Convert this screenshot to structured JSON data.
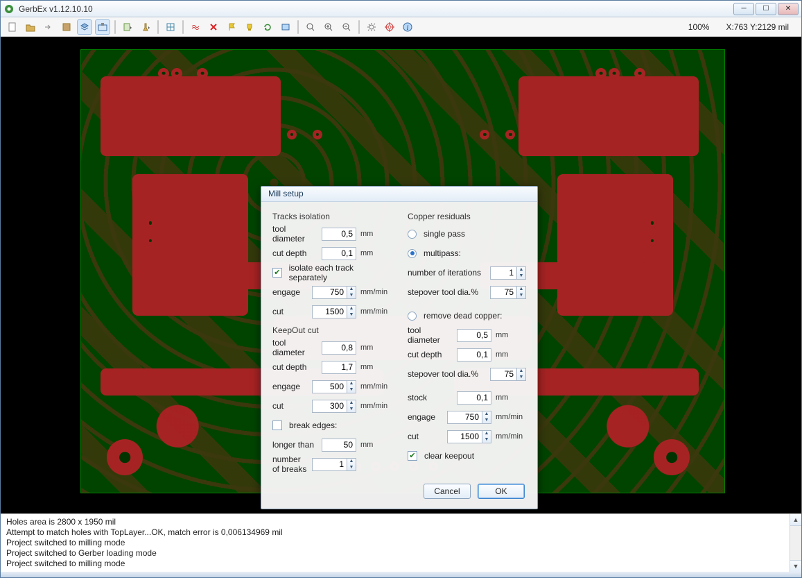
{
  "window": {
    "title": "GerbEx v1.12.10.10"
  },
  "toolbar": {
    "zoom": "100%",
    "coords": "X:763  Y:2129 mil",
    "icons": [
      "file-new-icon",
      "file-open-icon",
      "arrow-right-icon",
      "thumb-icon",
      "layers-icon",
      "cnc-icon",
      "sep",
      "gerber-dropdown-icon",
      "drill-dropdown-icon",
      "sep",
      "grid-icon",
      "sep",
      "approx-icon",
      "delete-x-icon",
      "flag-icon",
      "trophy-icon",
      "refresh-icon",
      "board-icon",
      "sep",
      "zoom-icon",
      "zoom-in-icon",
      "zoom-out-icon",
      "sep",
      "settings-gear-icon",
      "target-icon",
      "info-icon"
    ]
  },
  "dialog": {
    "title": "Mill setup",
    "tracks_isolation": {
      "heading": "Tracks isolation",
      "tool_diameter": {
        "label": "tool diameter",
        "value": "0,5",
        "unit": "mm"
      },
      "cut_depth": {
        "label": "cut depth",
        "value": "0,1",
        "unit": "mm"
      },
      "isolate_each": {
        "label": "isolate each track separately",
        "checked": true
      },
      "engage": {
        "label": "engage",
        "value": "750",
        "unit": "mm/min"
      },
      "cut": {
        "label": "cut",
        "value": "1500",
        "unit": "mm/min"
      }
    },
    "keepout_cut": {
      "heading": "KeepOut cut",
      "tool_diameter": {
        "label": "tool diameter",
        "value": "0,8",
        "unit": "mm"
      },
      "cut_depth": {
        "label": "cut depth",
        "value": "1,7",
        "unit": "mm"
      },
      "engage": {
        "label": "engage",
        "value": "500",
        "unit": "mm/min"
      },
      "cut": {
        "label": "cut",
        "value": "300",
        "unit": "mm/min"
      },
      "break_edges": {
        "label": "break edges:",
        "checked": false
      },
      "longer_than": {
        "label": "longer than",
        "value": "50",
        "unit": "mm"
      },
      "number_of_breaks": {
        "label": "number of breaks",
        "value": "1"
      }
    },
    "copper_residuals": {
      "heading": "Copper residuals",
      "single_pass": {
        "label": "single pass",
        "selected": false
      },
      "multipass": {
        "label": "multipass:",
        "selected": true
      },
      "number_of_iterations": {
        "label": "number of iterations",
        "value": "1"
      },
      "stepover_tool_dia": {
        "label": "stepover tool dia.%",
        "value": "75"
      },
      "remove_dead_copper": {
        "label": "remove dead copper:",
        "selected": false
      },
      "rdc_tool_diameter": {
        "label": "tool diameter",
        "value": "0,5",
        "unit": "mm"
      },
      "rdc_cut_depth": {
        "label": "cut depth",
        "value": "0,1",
        "unit": "mm"
      },
      "rdc_stepover": {
        "label": "stepover tool dia.%",
        "value": "75"
      },
      "stock": {
        "label": "stock",
        "value": "0,1",
        "unit": "mm"
      },
      "engage": {
        "label": "engage",
        "value": "750",
        "unit": "mm/min"
      },
      "cut": {
        "label": "cut",
        "value": "1500",
        "unit": "mm/min"
      },
      "clear_keepout": {
        "label": "clear keepout",
        "checked": true
      }
    },
    "buttons": {
      "cancel": "Cancel",
      "ok": "OK"
    }
  },
  "log": {
    "lines": [
      "Holes area is 2800 x 1950 mil",
      "Attempt to match holes with TopLayer...OK, match error is 0,006134969 mil",
      "Project switched to milling mode",
      "Project switched to Gerber loading mode",
      "Project switched to milling mode"
    ]
  }
}
